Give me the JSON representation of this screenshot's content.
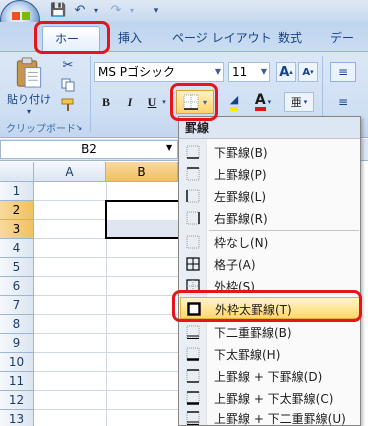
{
  "tabs": [
    "ホーム",
    "挿入",
    "ページ レイアウト",
    "数式",
    "データ"
  ],
  "clipboard": {
    "paste_label": "貼り付け",
    "group_label": "クリップボード"
  },
  "font": {
    "name": "MS Pゴシック",
    "size": "11",
    "bold": "B",
    "italic": "I",
    "underline": "U",
    "grow_icon": "A",
    "shrink_icon": "A"
  },
  "formula": {
    "name_box": "B2"
  },
  "columns": [
    "A",
    "B"
  ],
  "rows": [
    "1",
    "2",
    "3",
    "4",
    "5",
    "6",
    "7",
    "8",
    "9",
    "10",
    "11",
    "12",
    "13"
  ],
  "menu": {
    "title": "罫線",
    "items": [
      {
        "label": "下罫線(B)",
        "icon": "border-bottom-icon"
      },
      {
        "label": "上罫線(P)",
        "icon": "border-top-icon"
      },
      {
        "label": "左罫線(L)",
        "icon": "border-left-icon"
      },
      {
        "label": "右罫線(R)",
        "icon": "border-right-icon"
      },
      {
        "label": "枠なし(N)",
        "icon": "no-border-icon"
      },
      {
        "label": "格子(A)",
        "icon": "all-borders-icon"
      },
      {
        "label": "外枠(S)",
        "icon": "outside-borders-icon"
      },
      {
        "label": "外枠太罫線(T)",
        "icon": "thick-box-border-icon"
      },
      {
        "label": "下二重罫線(B)",
        "icon": "double-bottom-border-icon"
      },
      {
        "label": "下太罫線(H)",
        "icon": "thick-bottom-border-icon"
      },
      {
        "label": "上罫線 + 下罫線(D)",
        "icon": "top-bottom-border-icon"
      },
      {
        "label": "上罫線 + 下太罫線(C)",
        "icon": "top-thick-bottom-border-icon"
      },
      {
        "label": "上罫線 + 下二重罫線(U)",
        "icon": "top-double-bottom-border-icon"
      }
    ]
  },
  "colors": {
    "highlight": "#e8141b",
    "selected_item": "#ffd969",
    "ribbon": "#cfdff3"
  }
}
